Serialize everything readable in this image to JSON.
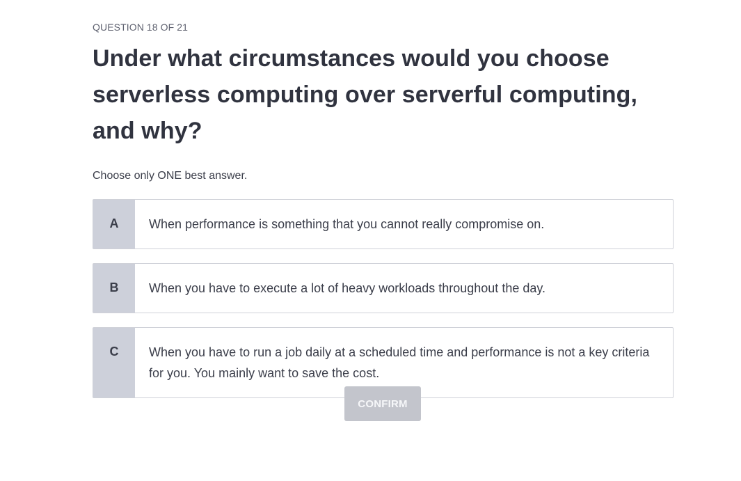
{
  "quiz": {
    "counter": "QUESTION 18 OF 21",
    "question": "Under what circumstances would you choose serverless computing over serverful computing, and why?",
    "instruction": "Choose only ONE best answer.",
    "options": [
      {
        "letter": "A",
        "text": "When performance is something that you cannot really compromise on."
      },
      {
        "letter": "B",
        "text": "When you have to execute a lot of heavy workloads throughout the day."
      },
      {
        "letter": "C",
        "text": "When you have to run a job daily at a scheduled time and performance is not a key criteria for you. You mainly want to save the cost."
      }
    ],
    "confirm_label": "CONFIRM",
    "confirm_enabled": false
  },
  "colors": {
    "letter_background": "#cdd0da",
    "option_border": "#cfd1d8",
    "confirm_disabled_background": "#c3c5cc",
    "text": "#3b3e4a"
  }
}
